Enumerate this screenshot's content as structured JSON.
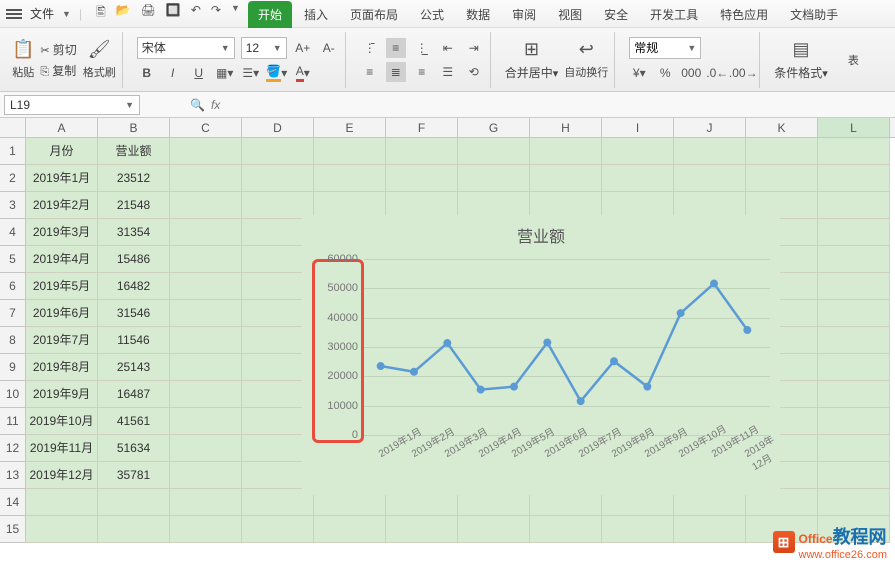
{
  "titlebar": {
    "file": "文件",
    "qat": [
      "🖺",
      "🗁",
      "🖨",
      "🖩",
      "↶",
      "↷"
    ]
  },
  "tabs": [
    "开始",
    "插入",
    "页面布局",
    "公式",
    "数据",
    "审阅",
    "视图",
    "安全",
    "开发工具",
    "特色应用",
    "文档助手"
  ],
  "active_tab": 0,
  "ribbon": {
    "paste": "粘贴",
    "cut": "剪切",
    "copy": "复制",
    "format_painter": "格式刷",
    "font_name": "宋体",
    "font_size": "12",
    "merge": "合并居中",
    "wrap": "自动换行",
    "number_format": "常规",
    "cond_format": "条件格式",
    "table": "表"
  },
  "namebox": "L19",
  "fx": "fx",
  "columns": [
    "A",
    "B",
    "C",
    "D",
    "E",
    "F",
    "G",
    "H",
    "I",
    "J",
    "K",
    "L"
  ],
  "table": {
    "headers": [
      "月份",
      "营业额"
    ],
    "rows": [
      [
        "2019年1月",
        "23512"
      ],
      [
        "2019年2月",
        "21548"
      ],
      [
        "2019年3月",
        "31354"
      ],
      [
        "2019年4月",
        "15486"
      ],
      [
        "2019年5月",
        "16482"
      ],
      [
        "2019年6月",
        "31546"
      ],
      [
        "2019年7月",
        "11546"
      ],
      [
        "2019年8月",
        "25143"
      ],
      [
        "2019年9月",
        "16487"
      ],
      [
        "2019年10月",
        "41561"
      ],
      [
        "2019年11月",
        "51634"
      ],
      [
        "2019年12月",
        "35781"
      ]
    ]
  },
  "chart_data": {
    "type": "line",
    "title": "营业额",
    "categories": [
      "2019年1月",
      "2019年2月",
      "2019年3月",
      "2019年4月",
      "2019年5月",
      "2019年6月",
      "2019年7月",
      "2019年8月",
      "2019年9月",
      "2019年10月",
      "2019年11月",
      "2019年12月"
    ],
    "values": [
      23512,
      21548,
      31354,
      15486,
      16482,
      31546,
      11546,
      25143,
      16487,
      41561,
      51634,
      35781
    ],
    "ylim": [
      0,
      60000
    ],
    "y_ticks": [
      0,
      10000,
      20000,
      30000,
      40000,
      50000,
      60000
    ],
    "xlabel": "",
    "ylabel": ""
  },
  "watermark": {
    "brand1": "Office",
    "brand2": "教程网",
    "url": "www.office26.com"
  }
}
